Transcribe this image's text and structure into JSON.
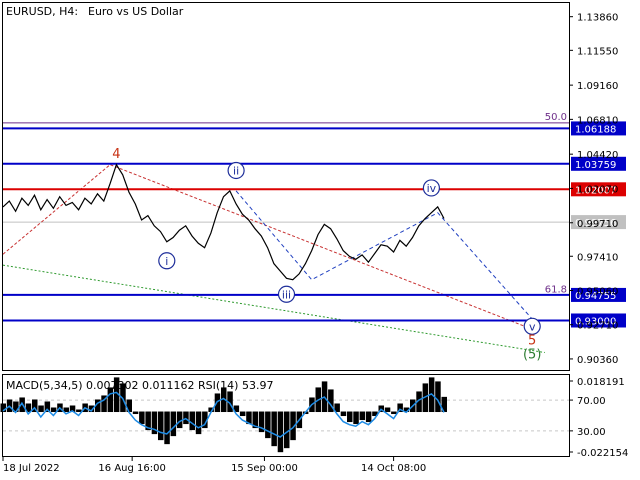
{
  "header": {
    "symbol": "EURUSD, H4:",
    "description": "Euro vs US Dollar"
  },
  "colors": {
    "price_line": "#000000",
    "support_resistance": "#0000c8",
    "red_level": "#dc0000",
    "fib_level": "#6e2f8a",
    "wave_label": "#1e2e9a",
    "wave4_label": "#c83214",
    "wave5_green": "#2e7d32",
    "trend_red": "#c83232",
    "trend_green": "#2e9a2e",
    "trend_blue": "#2040c0",
    "grid": "#c8c8c8",
    "macd_hist": "#000000",
    "rsi_line": "#1e8ce6",
    "current_price_bg": "#c0c0c0"
  },
  "chart_data": [
    {
      "type": "line",
      "title": "EURUSD, H4: Euro vs US Dollar",
      "x_tick_labels": [
        "18 Jul 2022",
        "16 Aug 16:00",
        "15 Sep 00:00",
        "14 Oct 08:00"
      ],
      "y_tick_labels": [
        "1.13860",
        "1.11550",
        "1.09160",
        "1.06810",
        "1.04420",
        "1.02070",
        "0.99710",
        "0.97410",
        "0.95060",
        "0.92710",
        "0.90360"
      ],
      "ylim": [
        0.896,
        1.148
      ],
      "series": [
        {
          "name": "",
          "values": [
            1.008,
            1.012,
            1.005,
            1.014,
            1.009,
            1.016,
            1.006,
            1.013,
            1.007,
            1.015,
            1.009,
            1.011,
            1.006,
            1.014,
            1.01,
            1.017,
            1.012,
            1.024,
            1.037,
            1.03,
            1.018,
            1.01,
            0.999,
            1.002,
            0.995,
            0.991,
            0.984,
            0.987,
            0.992,
            0.995,
            0.988,
            0.983,
            0.98,
            0.99,
            1.004,
            1.015,
            1.019,
            1.01,
            1.003,
            0.999,
            0.993,
            0.988,
            0.98,
            0.969,
            0.964,
            0.959,
            0.958,
            0.962,
            0.969,
            0.978,
            0.989,
            0.996,
            0.993,
            0.986,
            0.978,
            0.974,
            0.972,
            0.975,
            0.97,
            0.976,
            0.982,
            0.981,
            0.977,
            0.985,
            0.981,
            0.987,
            0.995,
            1.0,
            1.004,
            1.008,
            1.0
          ]
        }
      ],
      "levels": [
        {
          "price": "1.06188",
          "style": "blue"
        },
        {
          "price": "1.03759",
          "style": "blue"
        },
        {
          "price": "1.02007",
          "style": "red"
        },
        {
          "price": "0.94755",
          "style": "blue"
        },
        {
          "price": "0.93000",
          "style": "blue"
        }
      ],
      "current_price": "0.99756",
      "fib_labels": [
        {
          "text": "50.0",
          "price": 1.0705
        },
        {
          "text": "61.8",
          "price": 0.952
        }
      ],
      "wave_labels": [
        {
          "text": "4",
          "index": 18,
          "price": 1.045,
          "style": "plain"
        },
        {
          "text": "i",
          "index": 26,
          "price": 0.971,
          "style": "circled"
        },
        {
          "text": "ii",
          "index": 37,
          "price": 1.033,
          "style": "circled"
        },
        {
          "text": "iii",
          "index": 45,
          "price": 0.948,
          "style": "circled"
        },
        {
          "text": "iv",
          "index": 68,
          "price": 1.021,
          "style": "circled"
        },
        {
          "text": "v",
          "index": 84,
          "price": 0.926,
          "style": "circled"
        },
        {
          "text": "5",
          "index": 84,
          "price": 0.917,
          "style": "plain"
        },
        {
          "text": "(5)",
          "index": 84,
          "price": 0.9075,
          "style": "plain"
        }
      ]
    },
    {
      "type": "line",
      "title": "MACD(5,34,5) 0.007302 0.011162 RSI(14) 53.97",
      "y_tick_labels": [
        "0.018191",
        "70.00",
        "30.00",
        "-0.022154"
      ],
      "series": [
        {
          "name": "",
          "values": [
            0.004,
            0.006,
            0.005,
            0.007,
            0.004,
            0.006,
            0.003,
            0.005,
            0.002,
            0.004,
            0.002,
            0.003,
            0.001,
            0.004,
            0.003,
            0.006,
            0.008,
            0.012,
            0.017,
            0.014,
            0.006,
            -0.001,
            -0.006,
            -0.009,
            -0.011,
            -0.014,
            -0.016,
            -0.012,
            -0.008,
            -0.006,
            -0.009,
            -0.011,
            -0.008,
            0.002,
            0.009,
            0.012,
            0.01,
            0.003,
            -0.002,
            -0.006,
            -0.008,
            -0.01,
            -0.013,
            -0.017,
            -0.02,
            -0.018,
            -0.014,
            -0.008,
            -0.001,
            0.007,
            0.012,
            0.015,
            0.011,
            0.004,
            -0.002,
            -0.005,
            -0.006,
            -0.004,
            -0.005,
            -0.002,
            0.003,
            0.002,
            -0.001,
            0.004,
            0.002,
            0.006,
            0.01,
            0.014,
            0.017,
            0.015,
            0.0073
          ]
        },
        {
          "name": "",
          "values": [
            56,
            62,
            54,
            66,
            52,
            60,
            48,
            58,
            50,
            60,
            52,
            56,
            50,
            60,
            56,
            66,
            70,
            78,
            80,
            72,
            54,
            44,
            38,
            34,
            32,
            28,
            26,
            34,
            42,
            46,
            40,
            34,
            38,
            54,
            68,
            72,
            66,
            52,
            44,
            40,
            36,
            34,
            30,
            26,
            22,
            28,
            34,
            44,
            54,
            64,
            70,
            74,
            64,
            52,
            42,
            38,
            36,
            42,
            38,
            46,
            58,
            52,
            46,
            58,
            54,
            62,
            70,
            74,
            78,
            70,
            53.97
          ]
        }
      ]
    }
  ]
}
